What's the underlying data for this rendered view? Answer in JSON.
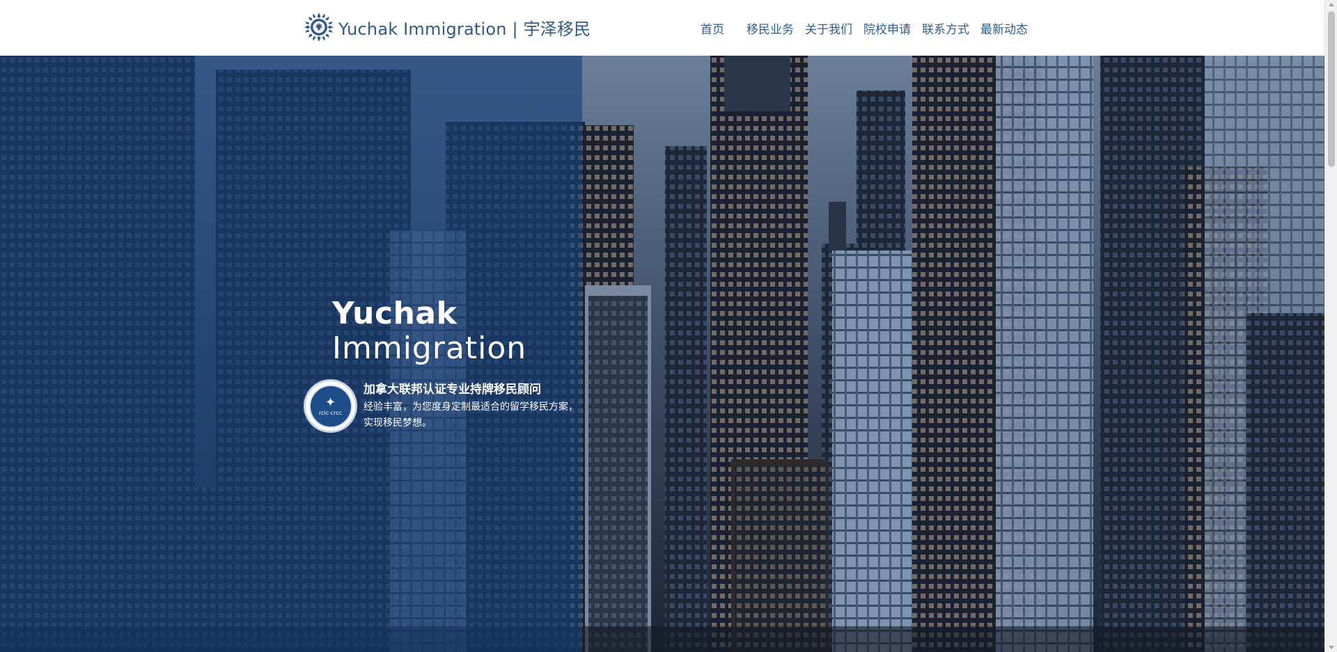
{
  "header": {
    "brand": "Yuchak Immigration | 宇泽移民",
    "logo_icon": "maple-wreath-logo-icon",
    "nav": [
      "首页",
      "移民业务",
      "关于我们",
      "院校申请",
      "联系方式",
      "最新动态"
    ]
  },
  "hero": {
    "title_line1": "Yuchak",
    "title_line2": "Immigration",
    "badge_text": "rcic·crcc",
    "badge_icon": "rcic-seal-icon",
    "tagline_heading": "加拿大联邦认证专业持牌移民顾问",
    "tagline_body": "经验丰富，为您度身定制最适合的留学移民方案，实现移民梦想。"
  },
  "colors": {
    "brand_blue": "#2e5a8c",
    "overlay_blue": "#16407a",
    "nav_text": "#2b5d93"
  }
}
